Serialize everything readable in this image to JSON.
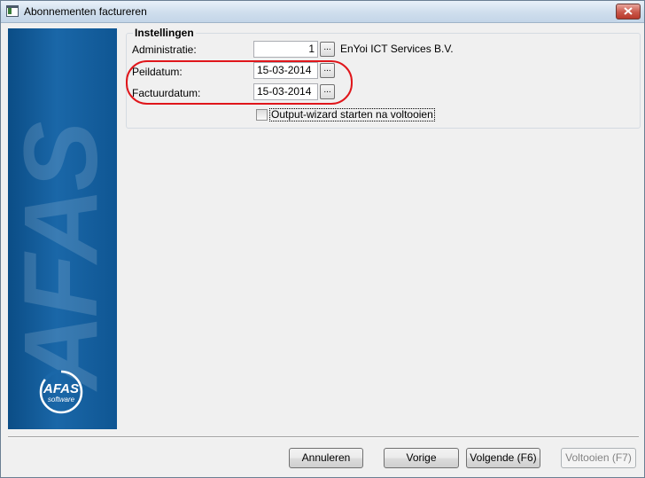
{
  "window": {
    "title": "Abonnementen factureren"
  },
  "sidebar": {
    "watermark": "AFAS",
    "logo_text": "AFAS",
    "logo_subtext": "software"
  },
  "settings": {
    "group_title": "Instellingen",
    "administratie": {
      "label": "Administratie:",
      "value": "1",
      "button": "...",
      "description": "EnYoi ICT Services B.V."
    },
    "peildatum": {
      "label": "Peildatum:",
      "value": "15-03-2014",
      "button": "..."
    },
    "factuurdatum": {
      "label": "Factuurdatum:",
      "value": "15-03-2014",
      "button": "..."
    },
    "output_wizard": {
      "label": "Output-wizard starten na voltooien",
      "checked": false
    }
  },
  "buttons": {
    "cancel": "Annuleren",
    "previous": "Vorige",
    "next": "Volgende (F6)",
    "finish": "Voltooien (F7)"
  },
  "colors": {
    "sidebar": "#1a67a8",
    "highlight": "#e0161b",
    "close": "#c9574a"
  }
}
